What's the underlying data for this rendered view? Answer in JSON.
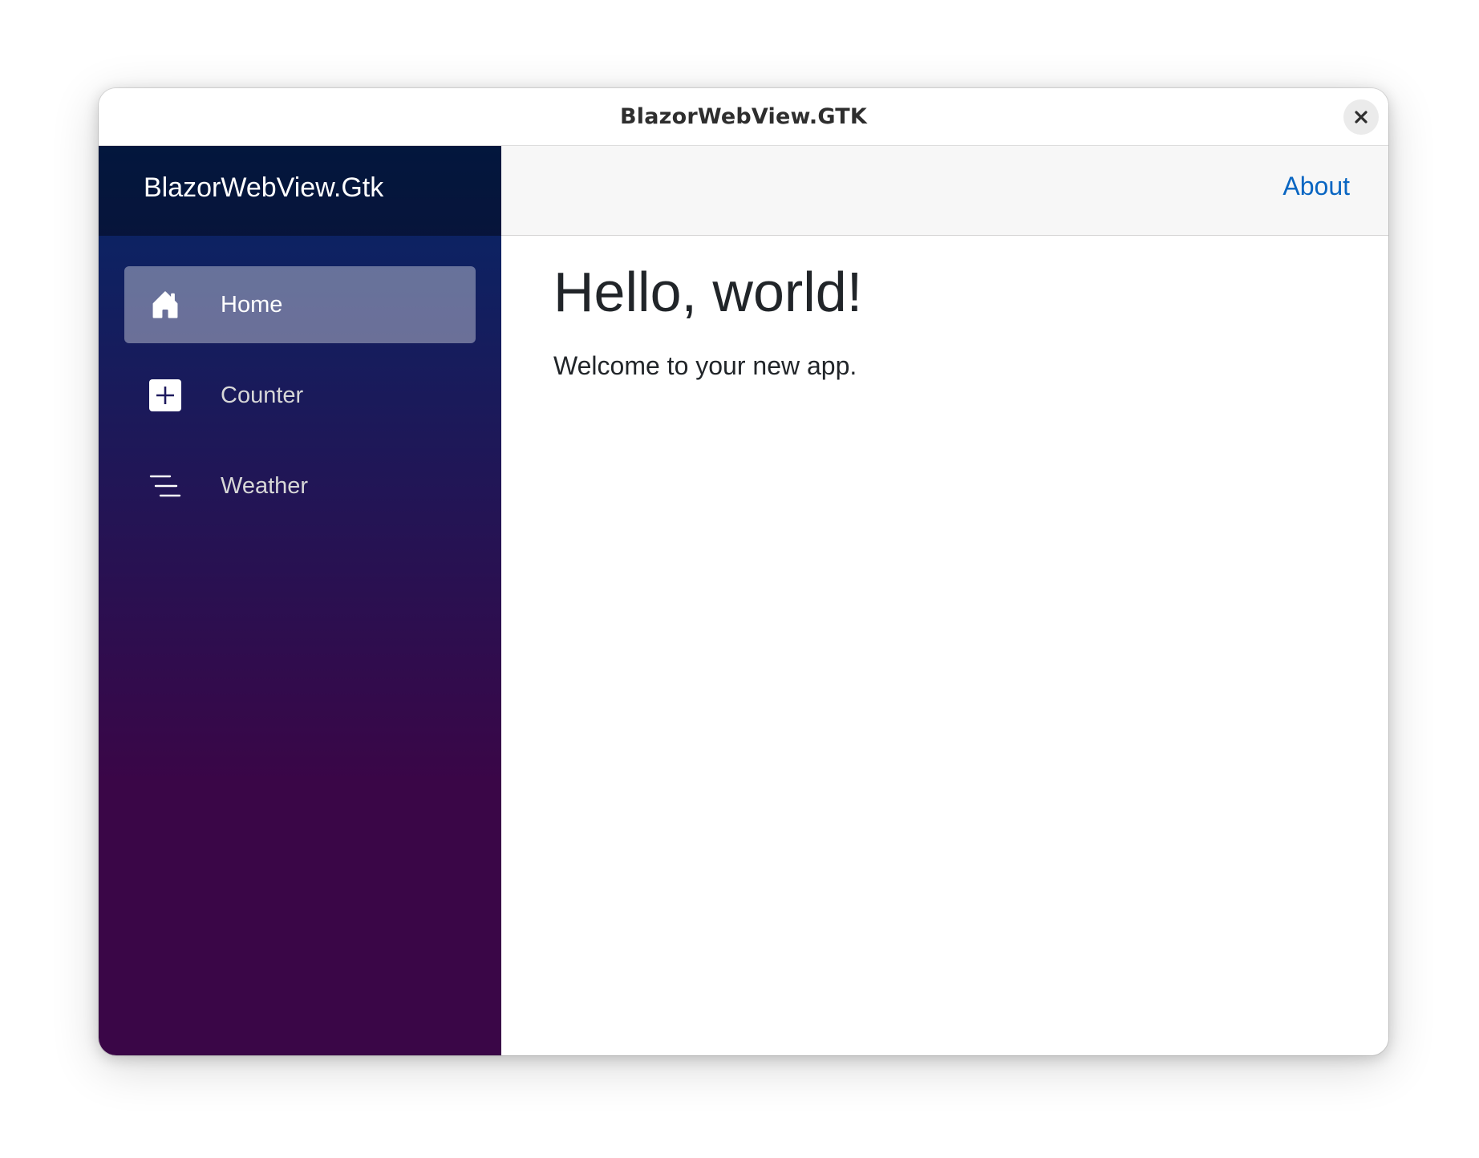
{
  "window": {
    "title": "BlazorWebView.GTK",
    "close_icon": "close-icon"
  },
  "sidebar": {
    "brand": "BlazorWebView.Gtk",
    "items": [
      {
        "label": "Home",
        "icon": "home-icon",
        "active": true
      },
      {
        "label": "Counter",
        "icon": "plus-square-icon",
        "active": false
      },
      {
        "label": "Weather",
        "icon": "list-icon",
        "active": false
      }
    ]
  },
  "top_row": {
    "about_label": "About"
  },
  "content": {
    "heading": "Hello, world!",
    "text": "Welcome to your new app."
  },
  "colors": {
    "sidebar_gradient_top": "#052767",
    "sidebar_gradient_bottom": "#3a0647",
    "link": "#0a66c2",
    "text": "#212529"
  }
}
